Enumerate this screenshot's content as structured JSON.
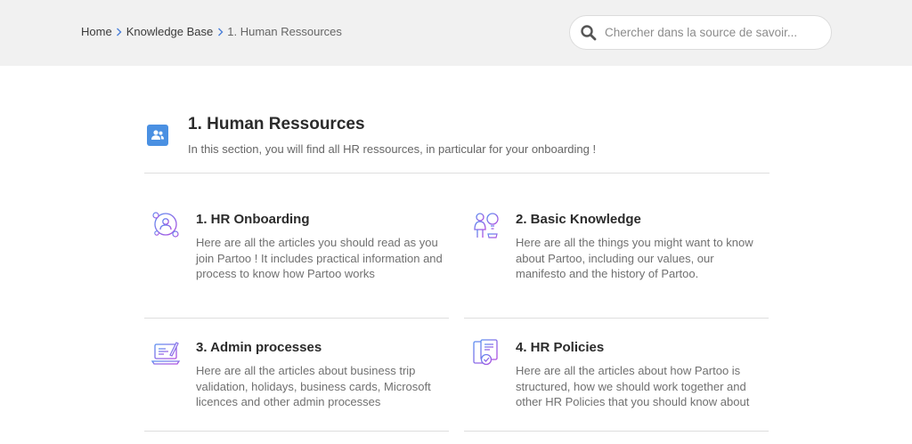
{
  "breadcrumb": {
    "home": "Home",
    "knowledge_base": "Knowledge Base",
    "current": "1. Human Ressources"
  },
  "search": {
    "placeholder": "Chercher dans la source de savoir..."
  },
  "section": {
    "title": "1. Human Ressources",
    "description": "In this section, you will find all HR ressources, in particular for your onboarding !",
    "icon": "people-icon",
    "icon_color": "#4a90e2"
  },
  "categories": [
    {
      "title": "1. HR Onboarding",
      "description": "Here are all the articles you should read as you join Partoo ! It includes practical information and process to know how Partoo works",
      "icon": "onboarding-icon"
    },
    {
      "title": "2. Basic Knowledge",
      "description": "Here are all the things you might want to know about Partoo, including our values, our manifesto and the history of Partoo.",
      "icon": "knowledge-icon"
    },
    {
      "title": "3. Admin processes",
      "description": "Here are all the articles about business trip validation, holidays, business cards, Microsoft licences and other admin processes",
      "icon": "laptop-icon"
    },
    {
      "title": "4. HR Policies",
      "description": "Here are all the articles about how Partoo is structured, how we should work together and other HR Policies that you should know about",
      "icon": "policy-icon"
    }
  ],
  "colors": {
    "accent": "#4a90e2",
    "icon_gradient_start": "#5b8ef0",
    "icon_gradient_end": "#b14ee0"
  }
}
